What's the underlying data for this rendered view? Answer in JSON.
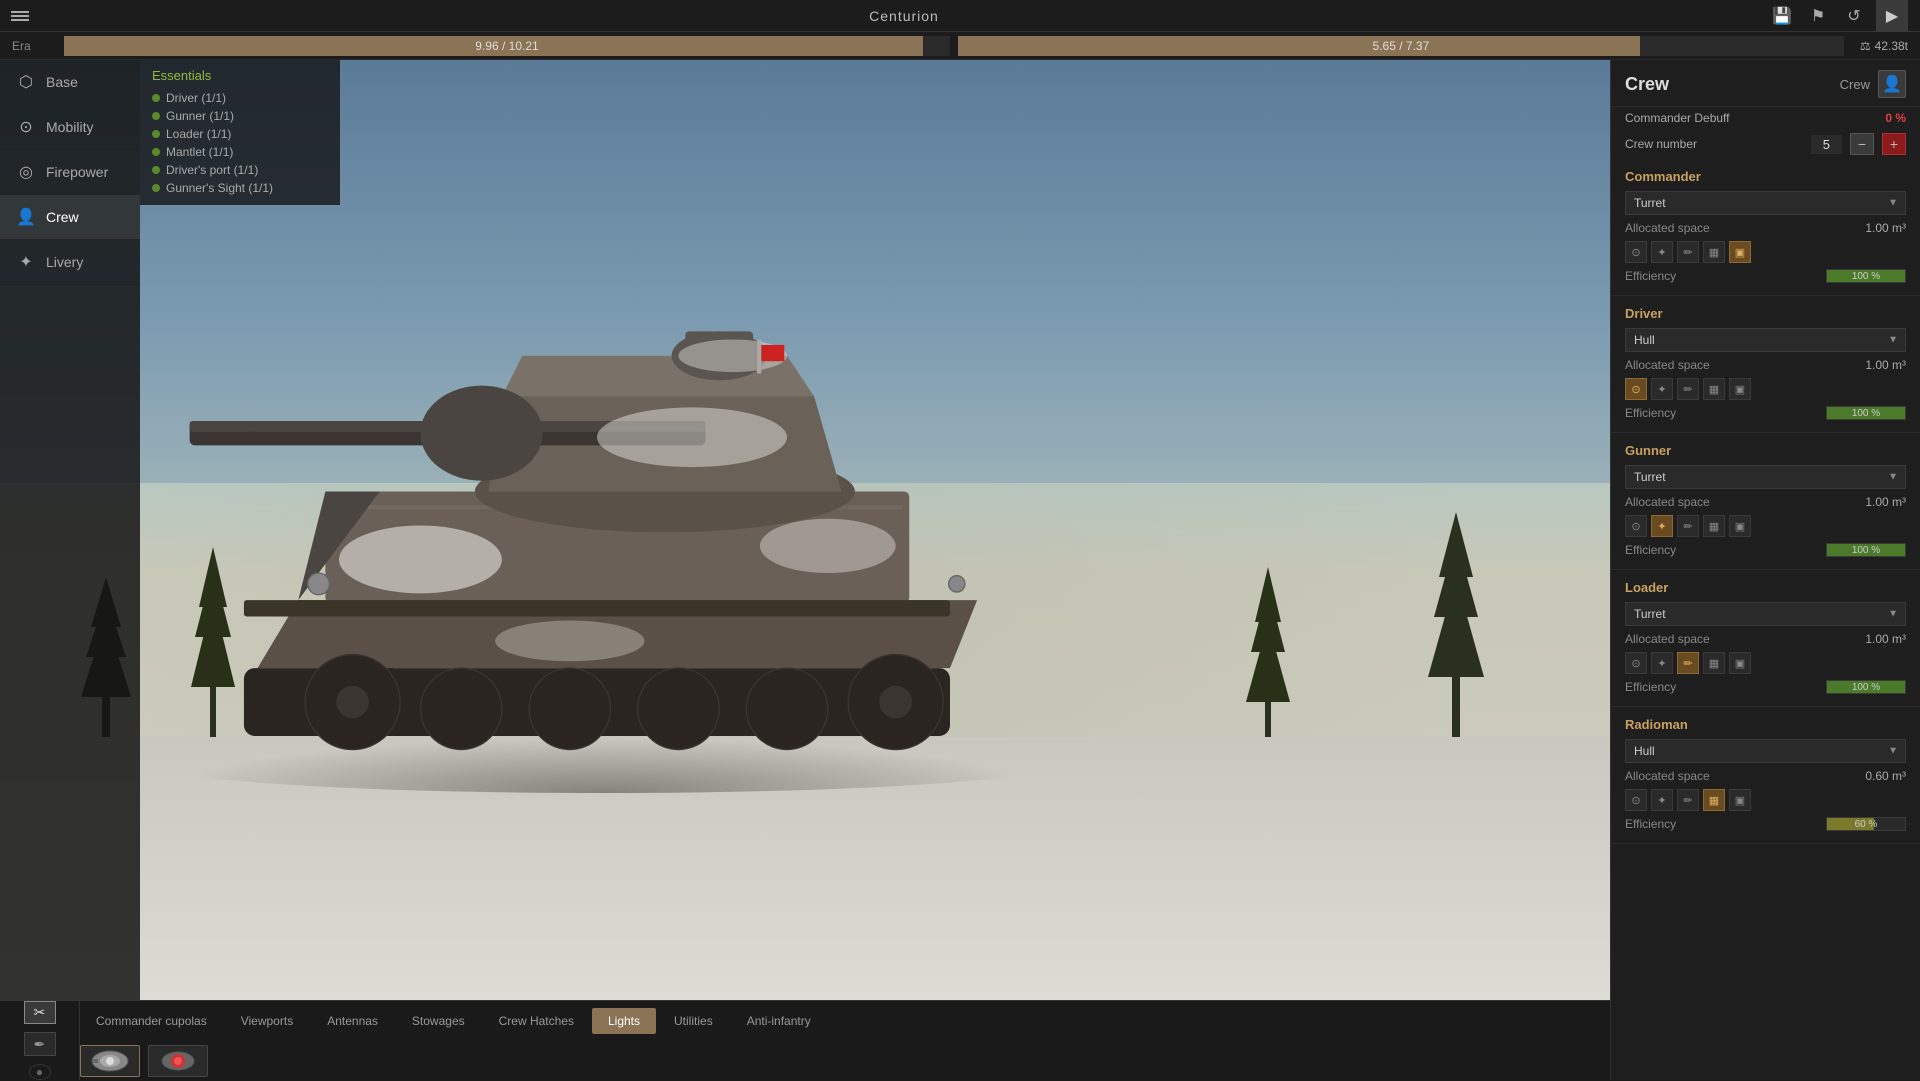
{
  "app": {
    "title": "Centurion",
    "era_label": "Era"
  },
  "stats": {
    "weight1_current": "9.96",
    "weight1_max": "10.21",
    "weight2_current": "5.65",
    "weight2_max": "7.37",
    "weight3": "42.38t",
    "weight1_fill_pct": 97,
    "weight2_fill_pct": 77
  },
  "sidebar": {
    "items": [
      {
        "id": "base",
        "label": "Base",
        "icon": "⬡"
      },
      {
        "id": "mobility",
        "label": "Mobility",
        "icon": "⊙"
      },
      {
        "id": "firepower",
        "label": "Firepower",
        "icon": "◎"
      },
      {
        "id": "crew",
        "label": "Crew",
        "icon": "👤"
      },
      {
        "id": "livery",
        "label": "Livery",
        "icon": "✦"
      }
    ]
  },
  "essentials": {
    "title": "Essentials",
    "items": [
      {
        "label": "Driver (1/1)"
      },
      {
        "label": "Gunner (1/1)"
      },
      {
        "label": "Loader (1/1)"
      },
      {
        "label": "Mantlet (1/1)"
      },
      {
        "label": "Driver's port (1/1)"
      },
      {
        "label": "Gunner's Sight (1/1)"
      }
    ]
  },
  "bottom_tabs": {
    "items": [
      {
        "id": "commander-cupolas",
        "label": "Commander cupolas",
        "active": false
      },
      {
        "id": "viewports",
        "label": "Viewports",
        "active": false
      },
      {
        "id": "antennas",
        "label": "Antennas",
        "active": false
      },
      {
        "id": "stowages",
        "label": "Stowages",
        "active": false
      },
      {
        "id": "crew-hatches",
        "label": "Crew Hatches",
        "active": false
      },
      {
        "id": "lights",
        "label": "Lights",
        "active": true
      },
      {
        "id": "utilities",
        "label": "Utilities",
        "active": false
      },
      {
        "id": "anti-infantry",
        "label": "Anti-infantry",
        "active": false
      }
    ]
  },
  "crew_panel": {
    "title": "Crew",
    "crew_label": "Crew",
    "commander_debuff_label": "Commander Debuff",
    "commander_debuff_value": "0 %",
    "crew_number_label": "Crew number",
    "crew_number_value": "5",
    "sections": [
      {
        "id": "commander",
        "title": "Commander",
        "position": "Turret",
        "allocated_space": "1.00 m³",
        "icons": [
          "⊙",
          "✦",
          "✏",
          "▦",
          "▣"
        ],
        "icon_active": [
          false,
          false,
          false,
          false,
          true
        ],
        "efficiency": 100,
        "efficiency_label": "100 %"
      },
      {
        "id": "driver",
        "title": "Driver",
        "position": "Hull",
        "allocated_space": "1.00 m³",
        "icons": [
          "⊙",
          "✦",
          "✏",
          "▦",
          "▣"
        ],
        "icon_active": [
          true,
          false,
          false,
          false,
          false
        ],
        "efficiency": 100,
        "efficiency_label": "100 %"
      },
      {
        "id": "gunner",
        "title": "Gunner",
        "position": "Turret",
        "allocated_space": "1.00 m³",
        "icons": [
          "⊙",
          "✦",
          "✏",
          "▦",
          "▣"
        ],
        "icon_active": [
          false,
          true,
          false,
          false,
          false
        ],
        "efficiency": 100,
        "efficiency_label": "100 %"
      },
      {
        "id": "loader",
        "title": "Loader",
        "position": "Turret",
        "allocated_space": "1.00 m³",
        "icons": [
          "⊙",
          "✦",
          "✏",
          "▦",
          "▣"
        ],
        "icon_active": [
          false,
          false,
          true,
          false,
          false
        ],
        "efficiency": 100,
        "efficiency_label": "100 %"
      },
      {
        "id": "radioman",
        "title": "Radioman",
        "position": "Hull",
        "allocated_space": "0.60 m³",
        "icons": [
          "⊙",
          "✦",
          "✏",
          "▦",
          "▣"
        ],
        "icon_active": [
          false,
          false,
          false,
          true,
          false
        ],
        "efficiency": 60,
        "efficiency_label": "60 %"
      }
    ]
  },
  "tools": {
    "tool1_icon": "✂",
    "tool2_icon": "✒",
    "circle_icon": "●"
  },
  "icons": {
    "hamburger": "☰",
    "save": "💾",
    "flag": "⚑",
    "refresh": "↺",
    "play": "▶"
  }
}
